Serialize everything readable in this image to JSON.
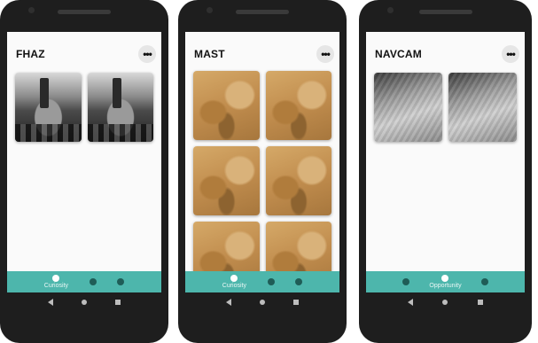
{
  "phones": [
    {
      "title": "FHAZ",
      "more_label": "•••",
      "thumbs": [
        "fhaz-photo",
        "fhaz-photo"
      ],
      "nav": [
        {
          "icon": "rover-icon",
          "label": "Curiosity",
          "active": true
        },
        {
          "icon": "rover-icon",
          "label": "",
          "active": false
        },
        {
          "icon": "rover-icon",
          "label": "",
          "active": false
        }
      ]
    },
    {
      "title": "MAST",
      "more_label": "•••",
      "thumbs": [
        "mast-photo",
        "mast-photo",
        "mast-photo",
        "mast-photo",
        "mast-photo",
        "mast-photo"
      ],
      "nav": [
        {
          "icon": "rover-icon",
          "label": "Curiosity",
          "active": true
        },
        {
          "icon": "rover-icon",
          "label": "",
          "active": false
        },
        {
          "icon": "rover-icon",
          "label": "",
          "active": false
        }
      ]
    },
    {
      "title": "NAVCAM",
      "more_label": "•••",
      "thumbs": [
        "navcam-photo",
        "navcam-photo"
      ],
      "nav": [
        {
          "icon": "rover-icon",
          "label": "",
          "active": false
        },
        {
          "icon": "rover-icon",
          "label": "Opportunity",
          "active": true
        },
        {
          "icon": "rover-icon",
          "label": "",
          "active": false
        }
      ]
    }
  ],
  "colors": {
    "bottom_nav": "#4db6ac",
    "screen_bg": "#fafafa",
    "phone_frame": "#1e1e1e"
  }
}
